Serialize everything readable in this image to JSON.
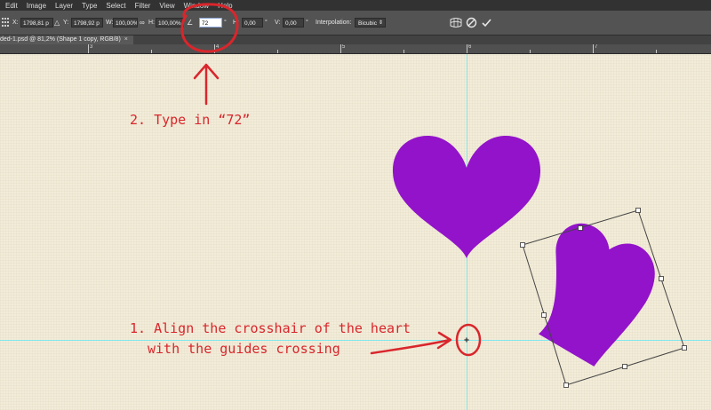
{
  "menu": [
    "Edit",
    "Image",
    "Layer",
    "Type",
    "Select",
    "Filter",
    "View",
    "Window",
    "Help"
  ],
  "options": {
    "x_label": "X:",
    "x_value": "1798,81 p",
    "y_label": "Y:",
    "y_value": "1798,92 p",
    "w_label": "W:",
    "w_value": "100,00%",
    "h_label": "H:",
    "h_value": "100,00%",
    "angle_value": "72",
    "angle_unit": "°",
    "hskew_label": "H:",
    "hskew_value": "0,00",
    "hskew_unit": "°",
    "vskew_label": "V:",
    "vskew_value": "0,00",
    "vskew_unit": "°",
    "interpolation_label": "Interpolation:",
    "interpolation_value": "Bicubic",
    "colors": {
      "bar": "#535353",
      "field": "#3d3d3d"
    }
  },
  "tab": {
    "title": "ded-1.psd @ 81,2% (Shape 1 copy, RGB/8)",
    "close": "×"
  },
  "ruler": {
    "labels": [
      "3",
      "4",
      "5",
      "6",
      "7"
    ]
  },
  "annotations": {
    "step2": "2. Type in “72”",
    "step1_line1": "1. Align the crosshair of the heart",
    "step1_line2": "with the guides crossing"
  },
  "colors": {
    "canvas": "#f2ecd9",
    "heart": "#9213c9",
    "guide": "#7fe8ec",
    "annotation": "#d9262c"
  }
}
